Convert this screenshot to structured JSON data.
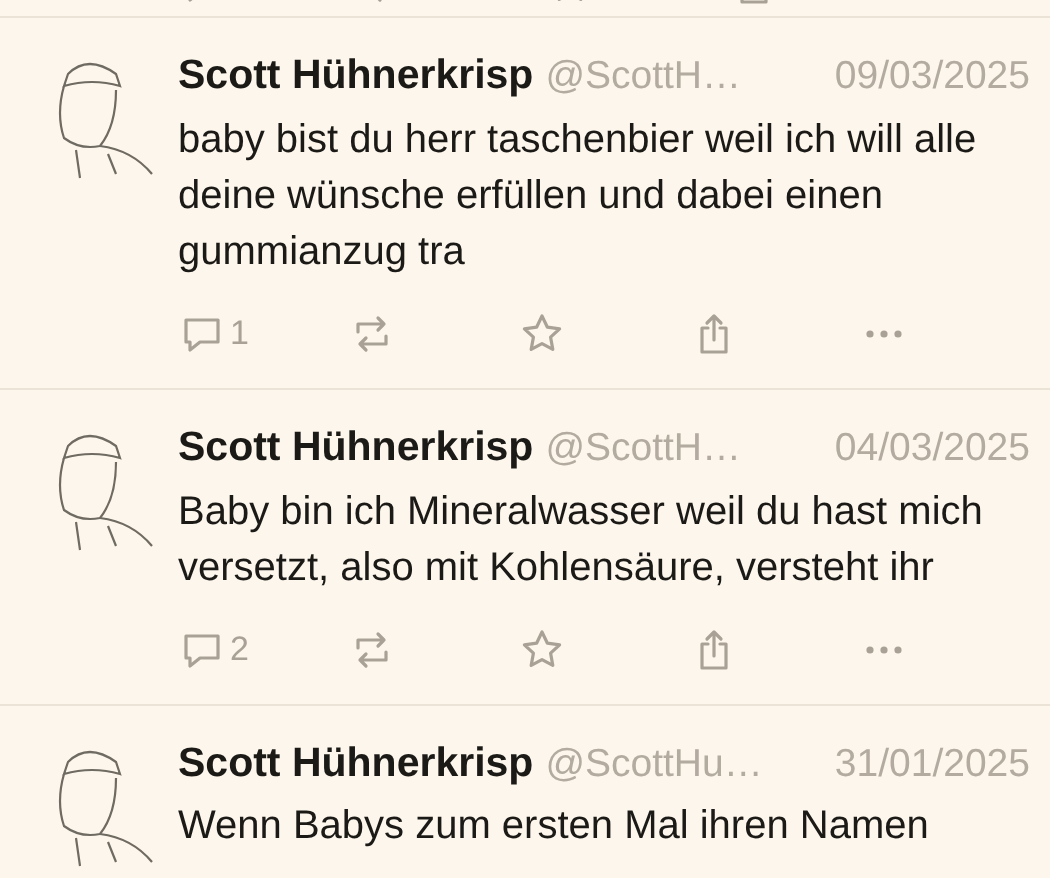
{
  "posts": [
    {
      "name": "Scott Hühnerkrisp",
      "handle": "@ScottH…",
      "date": "09/03/2025",
      "text": "baby bist du herr taschenbier weil ich will alle deine wünsche erfüllen und dabei einen gummianzug tra",
      "reply_count": "1"
    },
    {
      "name": "Scott Hühnerkrisp",
      "handle": "@ScottH…",
      "date": "04/03/2025",
      "text": "Baby bin ich Mineralwasser weil du hast mich versetzt, also mit Kohlensäure, versteht ihr",
      "reply_count": "2"
    },
    {
      "name": "Scott Hühnerkrisp",
      "handle": "@ScottHu…",
      "date": "31/01/2025",
      "text": "Wenn Babys zum ersten Mal ihren Namen"
    }
  ]
}
